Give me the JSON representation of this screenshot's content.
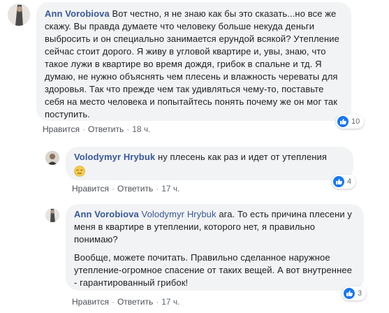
{
  "comments": [
    {
      "author": "Ann Vorobiova",
      "text": "Вот честно, я не знаю как бы это сказать...но все же скажу. Вы правда думаете что человеку больше некуда деньги выбросить и он специально занимается ерундой всякой? Утепление сейчас стоит дорого. Я живу в угловой квартире и, увы, знаю, что такое лужи в квартире во время дождя, грибок в спальне и тд. Я думаю, не нужно объяснять чем плесень и влажность череваты для здоровья. Так что прежде чем так удивляться чему-то, поставьте себя на место человека и попытайтесь понять почему же он мог так поступить.",
      "like_label": "Нравится",
      "reply_label": "Ответить",
      "time": "18 ч.",
      "reaction_count": "10"
    },
    {
      "author": "Volodymyr Hrybuk",
      "text": "ну плесень как раз и идет от утепления",
      "emoji": "expressionless-face",
      "like_label": "Нравится",
      "reply_label": "Ответить",
      "time": "17 ч.",
      "reaction_count": "4"
    },
    {
      "author": "Ann Vorobiova",
      "mention": "Volodymyr Hrybuk",
      "text": "ага. То есть причина плесени у меня в квартире в утеплении, которого нет, я правильно понимаю?",
      "text2": "Вообще, можете почитать. Правильно сделанное наружное утепление-огромное спасение от таких вещей. А вот внутреннее - гарантированный грибок!",
      "like_label": "Нравится",
      "reply_label": "Ответить",
      "time": "17 ч.",
      "reaction_count": "3"
    }
  ],
  "colors": {
    "link": "#385898",
    "bubble": "#f2f3f5",
    "like": "#1877f2"
  },
  "icons": {
    "reaction": "like-icon",
    "separator": "dot"
  }
}
